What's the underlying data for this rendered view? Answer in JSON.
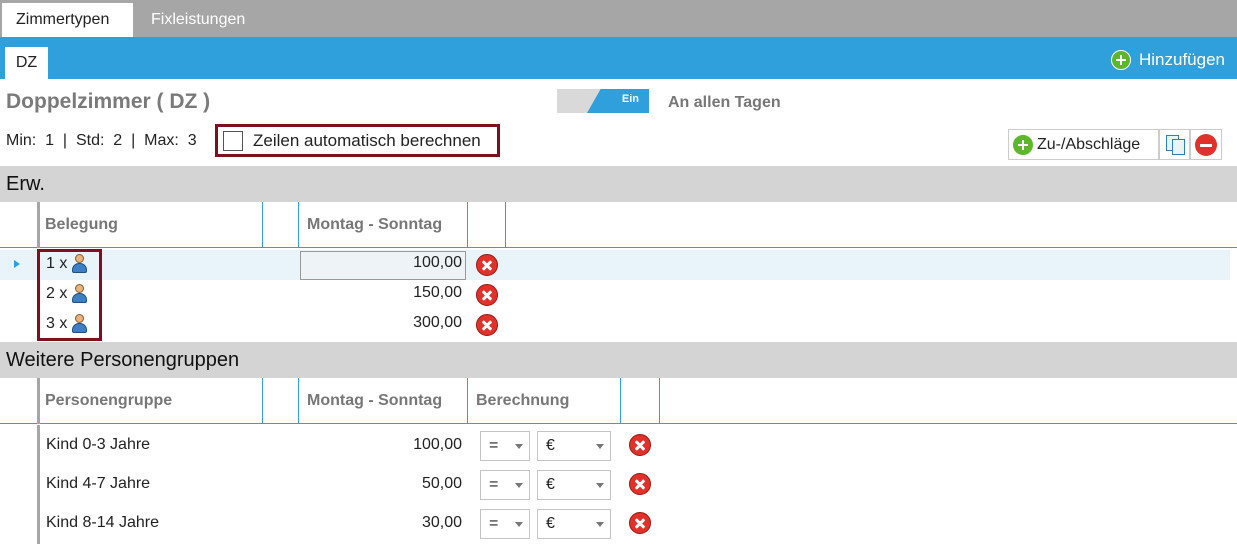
{
  "tabs": {
    "active": "Zimmertypen",
    "inactive": "Fixleistungen"
  },
  "subtab": "DZ",
  "add_button": "Hinzufügen",
  "room": {
    "title": "Doppelzimmer  ( DZ )",
    "toggle_label": "Ein",
    "days_label": "An allen Tagen",
    "minmax": "Min:  1  |  Std:  2  |  Max:  3",
    "autocalc_label": "Zeilen automatisch berechnen"
  },
  "toolbar": {
    "surcharge_label": "Zu-/Abschläge"
  },
  "section_adults": {
    "title": "Erw.",
    "col_occupancy": "Belegung",
    "col_price": "Montag - Sonntag",
    "rows": [
      {
        "occupancy": "1 x",
        "price": "100,00"
      },
      {
        "occupancy": "2 x",
        "price": "150,00"
      },
      {
        "occupancy": "3 x",
        "price": "300,00"
      }
    ]
  },
  "section_groups": {
    "title": "Weitere Personengruppen",
    "col_group": "Personengruppe",
    "col_price": "Montag - Sonntag",
    "col_calc": "Berechnung",
    "rows": [
      {
        "name": "Kind 0-3 Jahre",
        "price": "100,00",
        "operator": "=",
        "unit": "€"
      },
      {
        "name": "Kind 4-7 Jahre",
        "price": "50,00",
        "operator": "=",
        "unit": "€"
      },
      {
        "name": "Kind 8-14 Jahre",
        "price": "30,00",
        "operator": "=",
        "unit": "€"
      }
    ]
  }
}
